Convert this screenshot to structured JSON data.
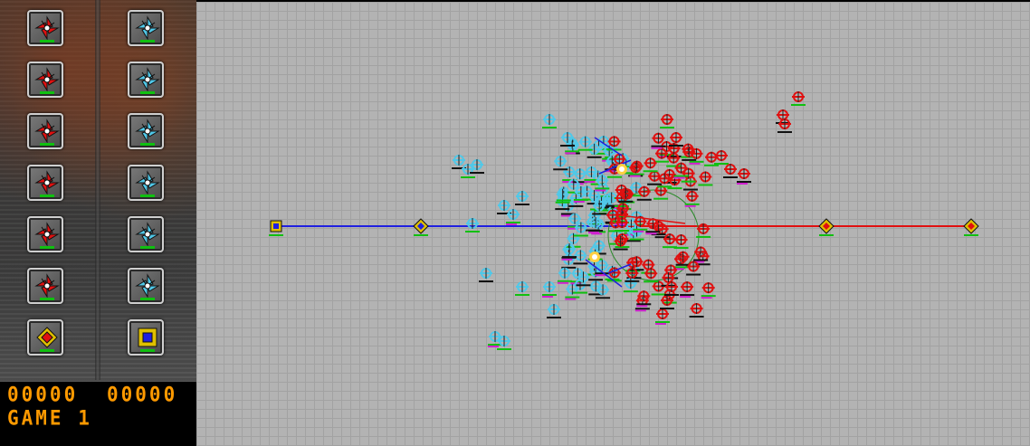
{
  "panel": {
    "left_column": [
      {
        "icon": "red-unit-icon",
        "team": "red"
      },
      {
        "icon": "red-unit-icon",
        "team": "red"
      },
      {
        "icon": "red-unit-icon",
        "team": "red"
      },
      {
        "icon": "red-unit-icon",
        "team": "red"
      },
      {
        "icon": "red-unit-icon",
        "team": "red"
      },
      {
        "icon": "red-unit-icon",
        "team": "red"
      },
      {
        "icon": "red-base-icon",
        "team": "red"
      }
    ],
    "right_column": [
      {
        "icon": "blue-unit-icon",
        "team": "blue"
      },
      {
        "icon": "blue-unit-icon",
        "team": "blue"
      },
      {
        "icon": "blue-unit-icon",
        "team": "blue"
      },
      {
        "icon": "blue-unit-icon",
        "team": "blue"
      },
      {
        "icon": "blue-unit-icon",
        "team": "blue"
      },
      {
        "icon": "blue-unit-icon",
        "team": "blue"
      },
      {
        "icon": "blue-base-icon",
        "team": "blue"
      }
    ]
  },
  "score": {
    "left": "00000",
    "right": "00000",
    "game_label": "GAME 1"
  },
  "colors": {
    "red_team": "#e01010",
    "blue_team": "#2020e0",
    "cyan_unit": "#50c8e8",
    "health_green": "#10c010",
    "shield_magenta": "#d020d0",
    "lcd_orange": "#ff9a00",
    "map_bg": "#b3b3b3"
  }
}
